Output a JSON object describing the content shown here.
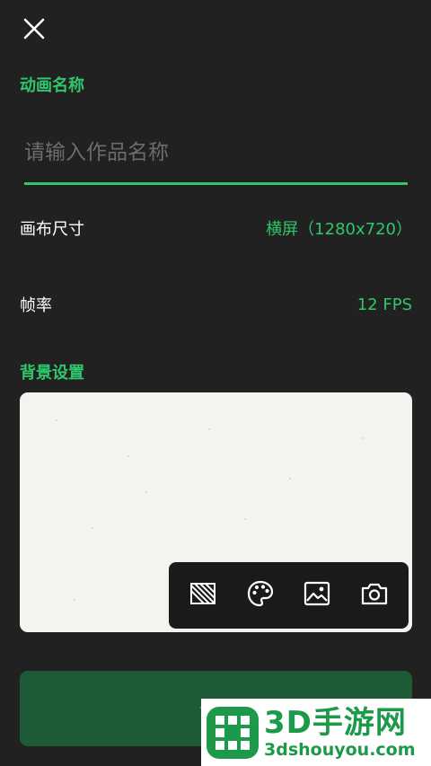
{
  "header": {
    "close_icon": "close-icon"
  },
  "name_section": {
    "label": "动画名称",
    "placeholder": "请输入作品名称",
    "value": ""
  },
  "canvas_size": {
    "label": "画布尺寸",
    "value": "横屏（1280x720）"
  },
  "frame_rate": {
    "label": "帧率",
    "value": "12 FPS"
  },
  "background": {
    "label": "背景设置",
    "tools": [
      {
        "name": "transparent-pattern-icon"
      },
      {
        "name": "palette-icon"
      },
      {
        "name": "image-icon"
      },
      {
        "name": "camera-icon"
      }
    ]
  },
  "create_button": {
    "label": "创建"
  },
  "watermark": {
    "title": "3D手游网",
    "url": "3dshouyou.com"
  },
  "colors": {
    "accent": "#2fc76c",
    "background": "#212121",
    "button_bg": "#1f5a37",
    "toolbar_bg": "#1a1a1a"
  }
}
